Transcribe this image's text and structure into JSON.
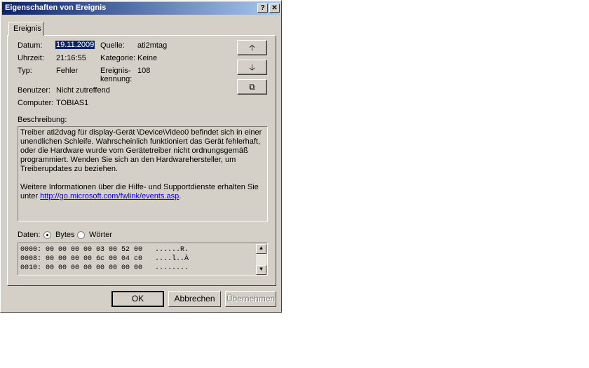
{
  "window": {
    "title": "Eigenschaften von Ereignis",
    "help_label": "?",
    "close_label": "✕"
  },
  "tab": {
    "label": "Ereignis"
  },
  "fields": {
    "datum_label": "Datum:",
    "datum_value": "19.11.2009",
    "uhrzeit_label": "Uhrzeit:",
    "uhrzeit_value": "21:16:55",
    "typ_label": "Typ:",
    "typ_value": "Fehler",
    "quelle_label": "Quelle:",
    "quelle_value": "ati2mtag",
    "kategorie_label": "Kategorie:",
    "kategorie_value": "Keine",
    "kennung_label_1": "Ereignis-",
    "kennung_label_2": "kennung:",
    "kennung_value": "108",
    "benutzer_label": "Benutzer:",
    "benutzer_value": "Nicht zutreffend",
    "computer_label": "Computer:",
    "computer_value": "TOBIAS1"
  },
  "side_buttons": {
    "up": "🡡",
    "down": "🡣",
    "copy": "⧉"
  },
  "description": {
    "label": "Beschreibung:",
    "text_1": "Treiber ati2dvag für display-Gerät \\Device\\Video0 befindet sich in einer unendlichen Schleife. Wahrscheinlich funktioniert das Gerät fehlerhaft, oder die Hardware wurde vom Gerätetreiber nicht ordnungsgemäß programmiert. Wenden Sie sich an den Hardwarehersteller, um Treiberupdates zu beziehen.",
    "text_2": "Weitere Informationen über die Hilfe- und Supportdienste erhalten Sie unter",
    "link": "http://go.microsoft.com/fwlink/events.asp",
    "text_end": "."
  },
  "data": {
    "label": "Daten:",
    "option_bytes": "Bytes",
    "option_words": "Wörter",
    "selected": "Bytes",
    "rows": [
      "0000: 00 00 00 00 03 00 52 00   ......R.",
      "0008: 00 00 00 00 6c 00 04 c0   ....l..À",
      "0010: 00 00 00 00 00 00 00 00   ........"
    ]
  },
  "buttons": {
    "ok": "OK",
    "cancel": "Abbrechen",
    "apply": "Übernehmen"
  },
  "icons": {
    "scroll_up": "▲",
    "scroll_down": "▼"
  },
  "colors": {
    "title_start": "#0a246a",
    "title_end": "#a6caf0",
    "face": "#d4d0c8",
    "link": "#0000ff"
  }
}
